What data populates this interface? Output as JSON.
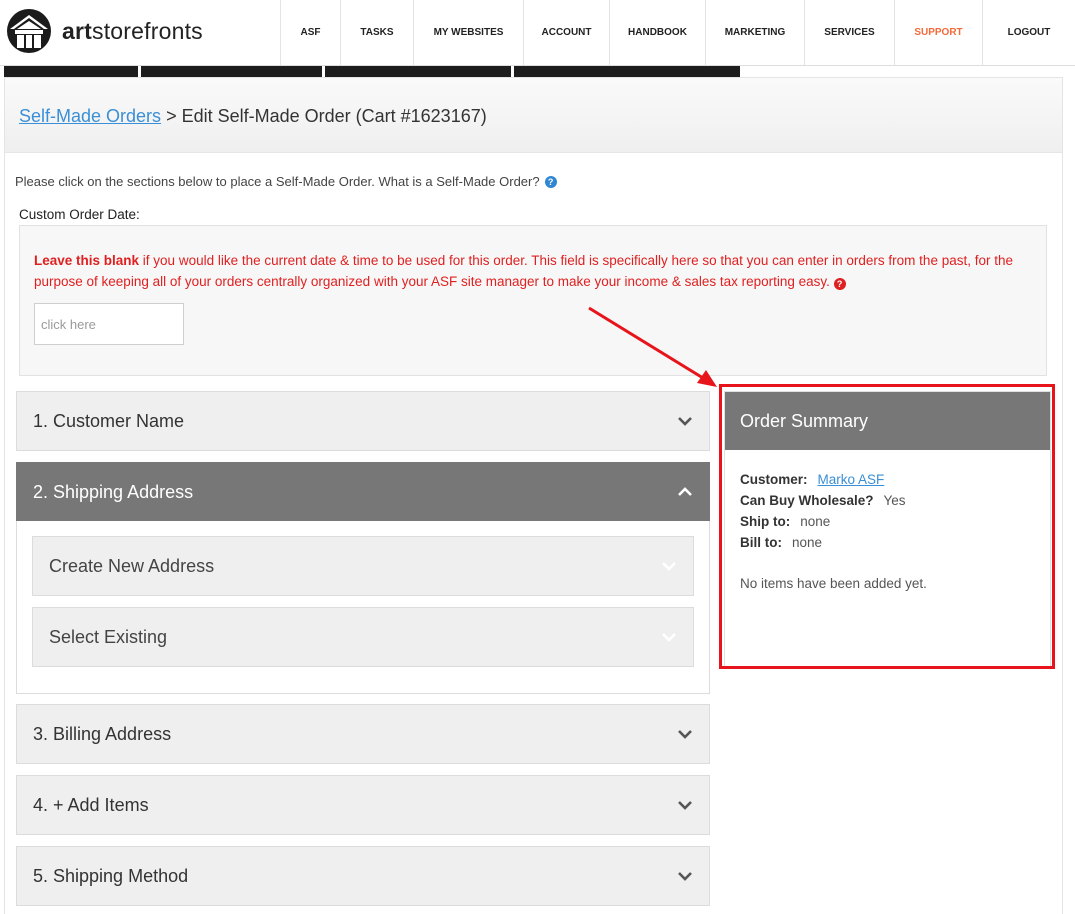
{
  "header": {
    "logo_text_bold": "art",
    "logo_text_rest": "storefronts",
    "nav": [
      "ASF",
      "TASKS",
      "MY WEBSITES",
      "ACCOUNT",
      "HANDBOOK",
      "MARKETING",
      "SERVICES",
      "SUPPORT",
      "LOGOUT"
    ],
    "accent_color": "#f26b3a"
  },
  "breadcrumb": {
    "link": "Self-Made Orders",
    "rest": " > Edit Self-Made Order (Cart #1623167)"
  },
  "intro_text": "Please click on the sections below to place a Self-Made Order. What is a Self-Made Order?",
  "custom_date": {
    "label": "Custom Order Date:",
    "note_bold": "Leave this blank",
    "note_rest": " if you would like the current date & time to be used for this order. This field is specifically here so that you can enter in orders from the past, for the purpose of keeping all of your orders centrally organized with your ASF site manager to make your income & sales tax reporting easy.",
    "placeholder": "click here"
  },
  "sections": {
    "customer_name": "1. Customer Name",
    "shipping_address": "2. Shipping Address",
    "create_new_address": "Create New Address",
    "select_existing": "Select Existing",
    "billing_address": "3. Billing Address",
    "add_items": "4. + Add Items",
    "shipping_method": "5. Shipping Method"
  },
  "summary": {
    "title": "Order Summary",
    "customer_label": "Customer:",
    "customer_value": "Marko ASF",
    "wholesale_label": "Can Buy Wholesale?",
    "wholesale_value": "Yes",
    "ship_label": "Ship to:",
    "ship_value": "none",
    "bill_label": "Bill to:",
    "bill_value": "none",
    "empty_text": "No items have been added yet."
  },
  "annotation_color": "#e8141b"
}
